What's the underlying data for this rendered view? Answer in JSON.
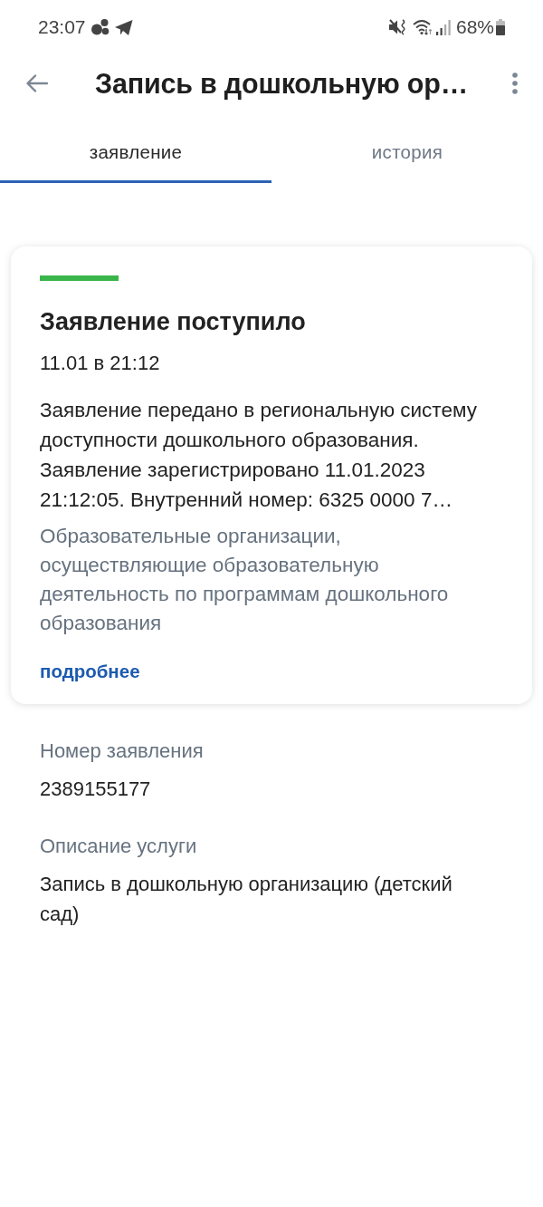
{
  "status_bar": {
    "time": "23:07",
    "battery": "68%"
  },
  "app_bar": {
    "title": "Запись в дошкольную ор…"
  },
  "tabs": [
    {
      "label": "заявление",
      "selected": true
    },
    {
      "label": "история",
      "selected": false
    }
  ],
  "status_card": {
    "title": "Заявление поступило",
    "date": "11.01 в 21:12",
    "message": "Заявление передано в региональную систему доступности дошкольного образования. Заявление зарегистрировано 11.01.2023 21:12:05. Внутренний номер: 6325 0000 7…",
    "organization": "Образовательные организации, осуществляющие образовательную деятельность по программам дошкольного образования",
    "link": "подробнее"
  },
  "details": [
    {
      "label": "Номер заявления",
      "value": "2389155177"
    },
    {
      "label": "Описание услуги",
      "value": "Запись в дошкольную организацию (детский сад)"
    }
  ]
}
